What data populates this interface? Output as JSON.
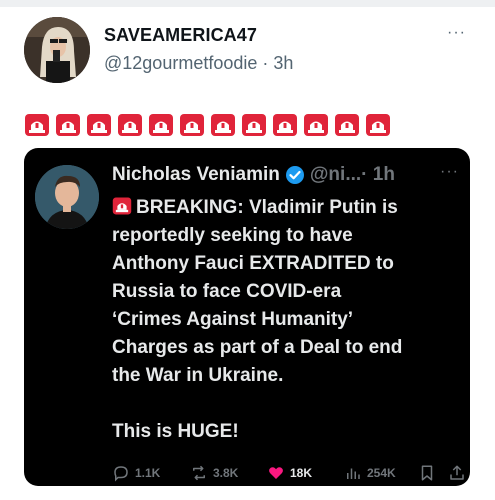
{
  "tweet": {
    "author_name": "SAVEAMERICA47",
    "handle_time": "@12gourmetfoodie · 3h",
    "more": "···",
    "sirens": 12
  },
  "quoted": {
    "name": "Nicholas Veniamin",
    "handle_time": "@ni...· 1h",
    "more": "···",
    "text_lines": [
      "BREAKING: Vladimir Putin is",
      "reportedly seeking to have",
      "Anthony Fauci EXTRADITED to",
      "Russia to face COVID-era",
      "‘Crimes Against Humanity’",
      "Charges as part of a Deal to end",
      "the War in Ukraine."
    ],
    "text_last": "This is HUGE!",
    "metrics": {
      "replies": "1.1K",
      "reposts": "3.8K",
      "likes": "18K",
      "views": "254K"
    }
  },
  "colors": {
    "siren_red": "#e0243a",
    "like_pink": "#f91880",
    "verified_blue": "#1d9bf0"
  }
}
